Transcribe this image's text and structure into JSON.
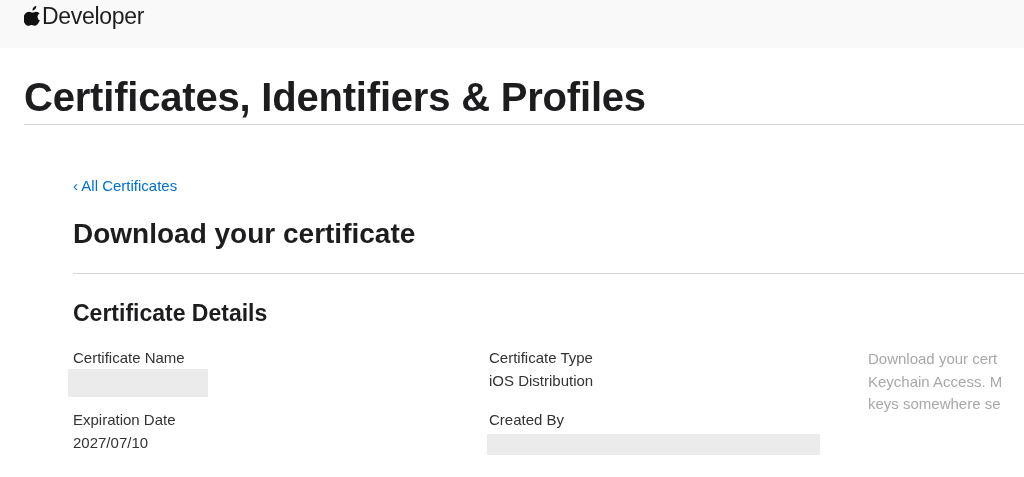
{
  "header": {
    "brand": "Developer"
  },
  "page_title": "Certificates, Identifiers & Profiles",
  "back_link": "‹ All Certificates",
  "heading": "Download your certificate",
  "section_title": "Certificate Details",
  "details": [
    {
      "label": "Certificate Name",
      "value": {
        "kind": "redacted"
      }
    },
    {
      "label": "Certificate Type",
      "value": {
        "kind": "text",
        "text": "iOS Distribution"
      }
    },
    {
      "label": "Expiration Date",
      "value": {
        "kind": "text",
        "text": "2027/07/10"
      }
    },
    {
      "label": "Created By",
      "value": {
        "kind": "redacted"
      }
    }
  ],
  "note_lines": [
    "Download your cert",
    "Keychain Access. M",
    "keys somewhere se"
  ]
}
